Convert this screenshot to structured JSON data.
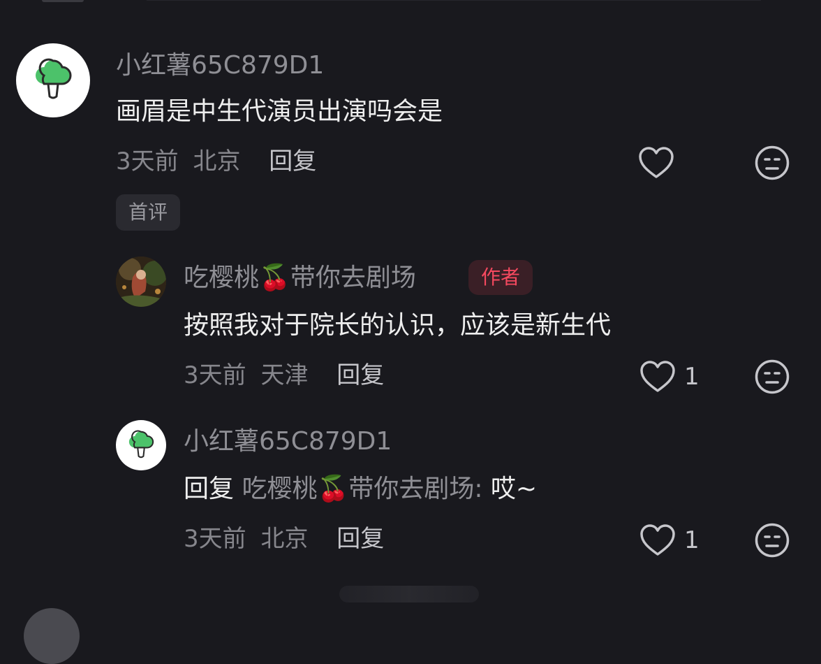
{
  "comments": [
    {
      "username": "小红薯65C879D1",
      "text": "画眉是中生代演员出演吗会是",
      "time": "3天前",
      "location": "北京",
      "reply_label": "回复",
      "like_count": "",
      "tag": "首评",
      "avatar_icon": "broccoli-avatar"
    }
  ],
  "replies": [
    {
      "username_prefix": "吃樱桃",
      "username_emoji": "🍒",
      "username_suffix": "带你去剧场",
      "author_badge": "作者",
      "text": "按照我对于院长的认识，应该是新生代",
      "time": "3天前",
      "location": "天津",
      "reply_label": "回复",
      "like_count": "1",
      "avatar_icon": "painting-avatar"
    },
    {
      "username": "小红薯65C879D1",
      "text_prefix": "回复",
      "text_target": "吃樱桃",
      "text_target_emoji": "🍒",
      "text_target_suffix": "带你去剧场:",
      "text_body": "哎~",
      "time": "3天前",
      "location": "北京",
      "reply_label": "回复",
      "like_count": "1",
      "avatar_icon": "broccoli-avatar"
    }
  ],
  "icons": {
    "like": "heart-outline-icon",
    "dislike": "meh-face-icon"
  },
  "colors": {
    "background": "#19191e",
    "author_badge_text": "#f5495f",
    "broccoli": "#4cc26a"
  }
}
